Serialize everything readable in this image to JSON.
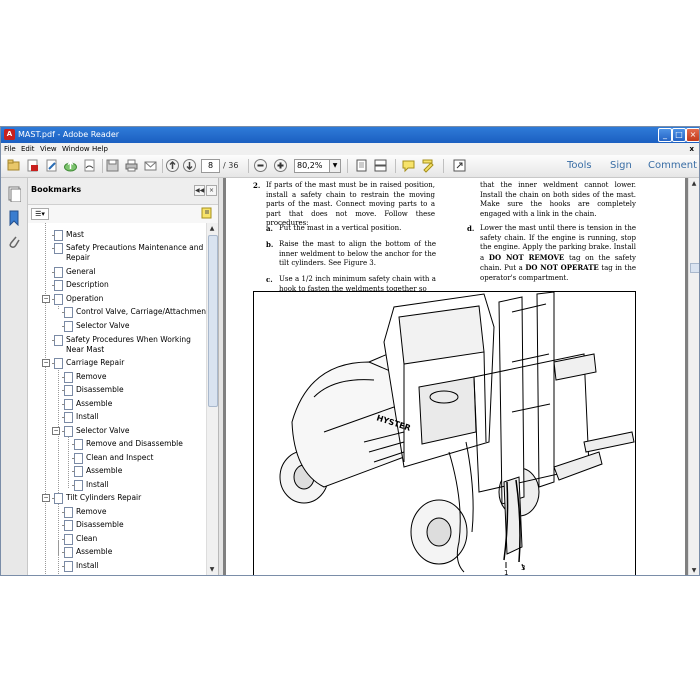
{
  "window": {
    "title": "MAST.pdf - Adobe Reader",
    "app_icon": "adobe-reader-icon",
    "controls": [
      "minimize-icon",
      "maximize-icon",
      "close-icon"
    ]
  },
  "menu": {
    "items": [
      "File",
      "Edit",
      "View",
      "Window",
      "Help"
    ],
    "close_glyph": "x"
  },
  "toolbar": {
    "page_current": "8",
    "page_total": "/ 36",
    "zoom": "80,2%",
    "links": {
      "tools": "Tools",
      "sign": "Sign",
      "comment": "Comment"
    }
  },
  "bookmarks": {
    "title": "Bookmarks",
    "items": [
      {
        "label": "Mast"
      },
      {
        "label": "Safety Precautions Maintenance and Repair"
      },
      {
        "label": "General"
      },
      {
        "label": "Description"
      },
      {
        "label": "Operation"
      },
      {
        "label": "Control Valve, Carriage/Attachment"
      },
      {
        "label": "Selector Valve"
      },
      {
        "label": "Safety Procedures When Working Near Mast"
      },
      {
        "label": "Carriage Repair"
      },
      {
        "label": "Remove"
      },
      {
        "label": "Disassemble"
      },
      {
        "label": "Assemble"
      },
      {
        "label": "Install"
      },
      {
        "label": "Selector Valve"
      },
      {
        "label": "Remove and Disassemble"
      },
      {
        "label": "Clean and Inspect"
      },
      {
        "label": "Assemble"
      },
      {
        "label": "Install"
      },
      {
        "label": "Tilt Cylinders Repair"
      },
      {
        "label": "Remove"
      },
      {
        "label": "Disassemble"
      },
      {
        "label": "Clean"
      },
      {
        "label": "Assemble"
      },
      {
        "label": "Install"
      }
    ]
  },
  "document": {
    "left": {
      "p2_num": "2.",
      "p2": "If parts of the mast must be in raised position, install a safety chain to restrain the moving parts of the mast. Connect moving parts to a part that does not move. Follow these procedures:",
      "pa_num": "a.",
      "pa": "Put the mast in a vertical position.",
      "pb_num": "b.",
      "pb": "Raise the mast to align the bottom of the inner weldment to below the anchor for the tilt cylinders. See Figure 3.",
      "pc_num": "c.",
      "pc": "Use a 1/2 inch minimum safety chain with a hook to fasten the weldments together so"
    },
    "right": {
      "cont": "that the inner weldment cannot lower. Install the chain on both sides of the mast. Make sure the hooks are completely engaged with a link in the chain.",
      "pd_num": "d.",
      "pd_1": "Lower the mast until there is tension in the safety chain. If the engine is running, stop the engine. Apply the parking brake. Install a",
      "pd_b1": "DO NOT REMOVE",
      "pd_2": "tag on the safety chain. Put a",
      "pd_b2": "DO NOT OPERATE",
      "pd_3": "tag in the operator's compartment."
    },
    "figure": {
      "brand": "HYSTER",
      "callout_1": "1",
      "callout_3": "3"
    }
  }
}
